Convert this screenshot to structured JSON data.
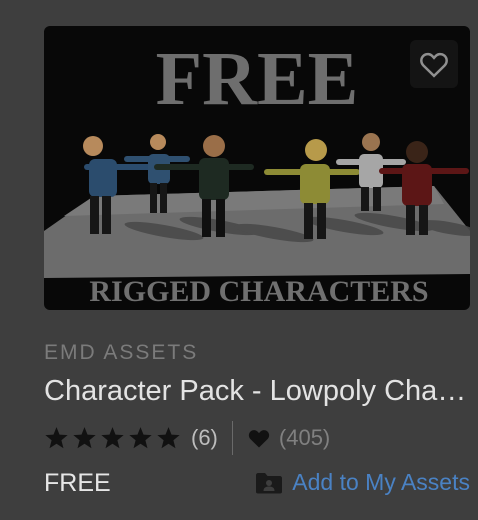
{
  "product": {
    "image_text_top": "FREE",
    "image_text_bottom": "RIGGED CHARACTERS",
    "publisher": "EMD ASSETS",
    "title": "Character Pack - Lowpoly Characters",
    "rating": 5,
    "rating_count": "(6)",
    "favorites_count": "(405)",
    "price": "FREE",
    "add_label": "Add to My Assets"
  },
  "colors": {
    "background": "#3e3e3e",
    "link": "#4a82c4",
    "star": "#111111"
  },
  "icons": [
    "heart-outline-icon",
    "star-icon",
    "heart-icon",
    "folder-user-icon"
  ]
}
